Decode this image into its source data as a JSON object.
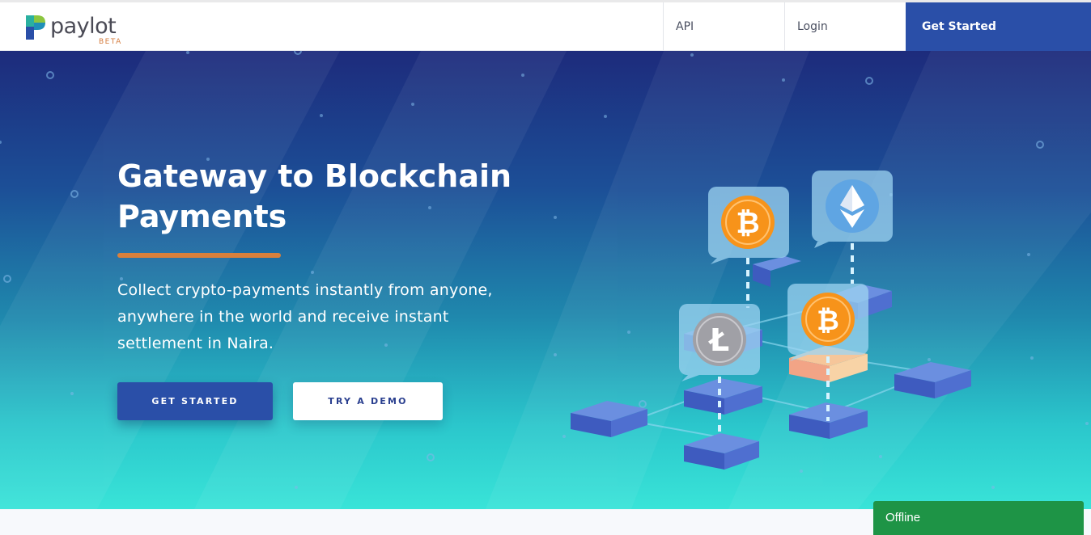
{
  "header": {
    "logo_text": "paylot",
    "logo_badge": "BETA",
    "nav": {
      "api": "API",
      "login": "Login",
      "get_started": "Get Started"
    }
  },
  "hero": {
    "title": "Gateway to Blockchain Payments",
    "description": "Collect crypto-payments instantly from anyone, anywhere in the world and receive instant settlement in Naira.",
    "primary_button": "GET STARTED",
    "secondary_button": "TRY A DEMO"
  },
  "illustration": {
    "icons": [
      "bitcoin-icon",
      "ethereum-icon",
      "litecoin-icon",
      "bitcoin-icon"
    ]
  },
  "chat_widget": {
    "status": "Offline"
  },
  "colors": {
    "brand_blue": "#2a4fa8",
    "accent_orange": "#d9803c",
    "offline_green": "#1e9446"
  }
}
